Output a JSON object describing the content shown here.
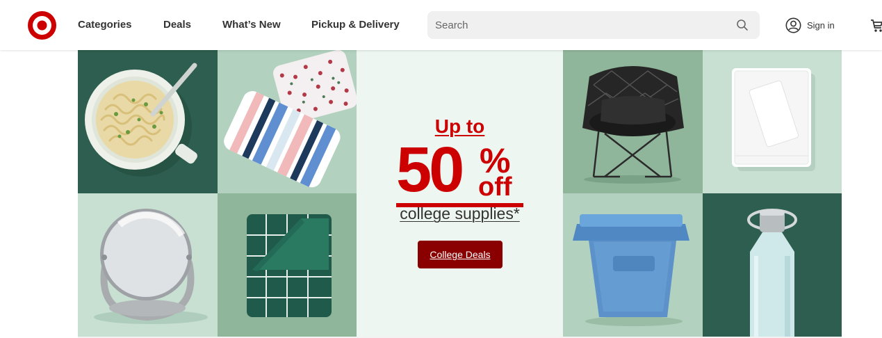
{
  "header": {
    "logo": "target-bullseye-logo",
    "nav": [
      {
        "label": "Categories"
      },
      {
        "label": "Deals"
      },
      {
        "label": "What’s New"
      },
      {
        "label": "Pickup & Delivery"
      }
    ],
    "search": {
      "placeholder": "Search",
      "value": ""
    },
    "signin_label": "Sign in"
  },
  "hero": {
    "promo": {
      "line1": "Up to",
      "big_number": "50",
      "percent": "%",
      "off": "off",
      "subtitle": "college supplies*",
      "button_label": "College Deals"
    },
    "tiles": [
      "ramen-bowl-image",
      "pillows-image",
      "makeup-mirror-image",
      "folded-comforter-image",
      "bungee-chair-image",
      "folded-sheets-image",
      "storage-bin-image",
      "water-bottle-image"
    ]
  },
  "colors": {
    "brand_red": "#cc0000",
    "button_dark_red": "#8a0000",
    "dark_green": "#2d5e4f",
    "mid_green": "#8fb59a",
    "light_green": "#c8e0d2",
    "center_bg": "#eef6f1"
  }
}
